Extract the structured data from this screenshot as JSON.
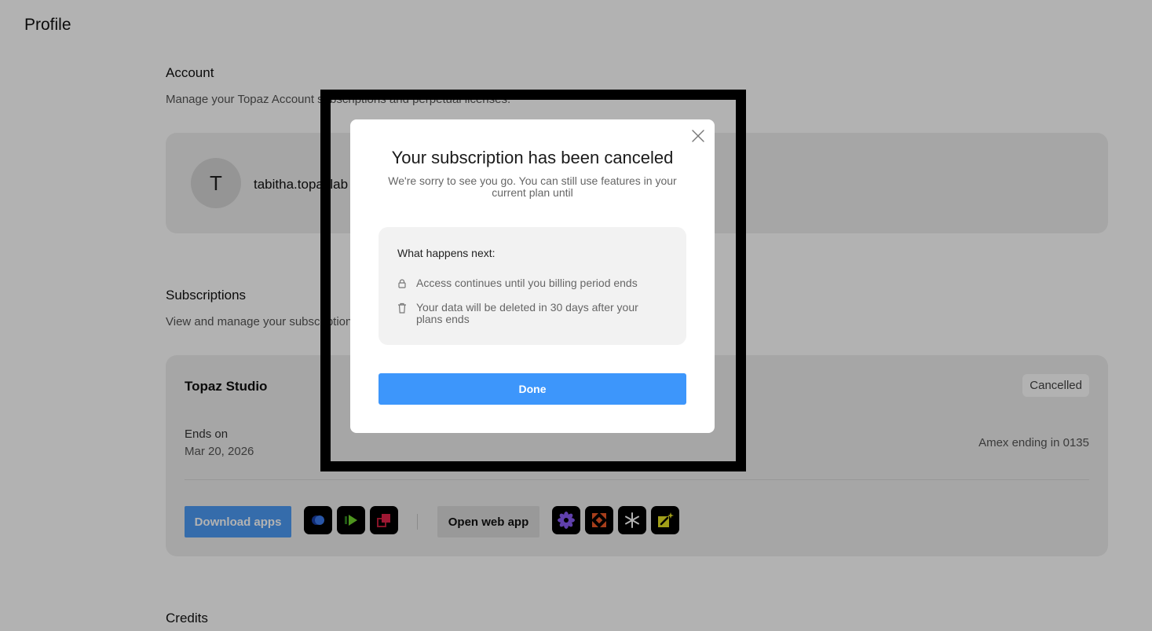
{
  "page": {
    "title": "Profile"
  },
  "account": {
    "title": "Account",
    "description": "Manage your Topaz Account subscriptions and perpetual licenses.",
    "avatar_initial": "T",
    "email": "tabitha.topazlab"
  },
  "subscriptions": {
    "title": "Subscriptions",
    "description": "View and manage your subscriptions",
    "product_name": "Topaz Studio",
    "status": "Cancelled",
    "ends_label": "Ends on",
    "ends_date": "Mar 20, 2026",
    "payment": "Amex ending in 0135",
    "download_label": "Download apps",
    "open_web_label": "Open web app",
    "desktop_apps": [
      "photo-app-icon",
      "video-app-icon",
      "gigapixel-app-icon"
    ],
    "web_apps": [
      "bloom-app-icon",
      "expand-app-icon",
      "sparkle-app-icon",
      "edit-app-icon"
    ]
  },
  "credits": {
    "title": "Credits"
  },
  "modal": {
    "title": "Your subscription has been canceled",
    "subtitle": "We're sorry to see you go. You can still use features in your current plan until",
    "next_heading": "What happens next:",
    "items": [
      {
        "icon": "lock-icon",
        "text": "Access continues until you billing period ends"
      },
      {
        "icon": "trash-icon",
        "text": "Your data will be deleted in 30 days after your plans ends"
      }
    ],
    "done_label": "Done"
  },
  "colors": {
    "accent": "#3d96fb",
    "overlay": "rgba(0,0,0,0.30)"
  }
}
